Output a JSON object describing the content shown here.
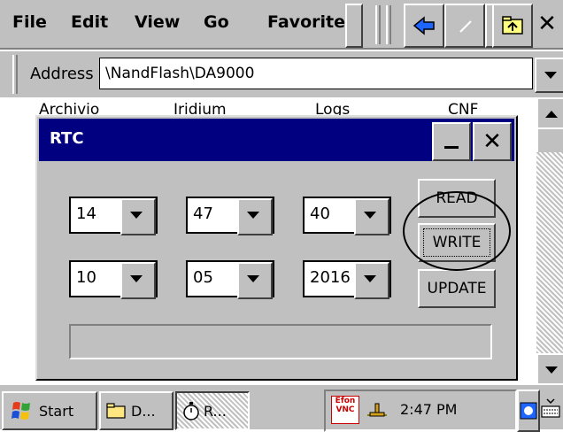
{
  "menubar": {
    "file": "File",
    "edit": "Edit",
    "view": "View",
    "go": "Go",
    "favorites": "Favorites",
    "icons": [
      "back-icon",
      "stop-icon",
      "folder-up-icon",
      "close-icon"
    ]
  },
  "address": {
    "label": "Address",
    "value": "\\NandFlash\\DA9000"
  },
  "folder_headers": [
    "Archivio",
    "Iridium",
    "Logs",
    "CNF"
  ],
  "dialog": {
    "title": "RTC",
    "time": {
      "hour": "14",
      "minute": "47",
      "second": "40"
    },
    "date": {
      "day": "10",
      "month": "05",
      "year": "2016"
    },
    "buttons": {
      "read": "READ",
      "write": "WRITE",
      "update": "UPDATE"
    },
    "status": ""
  },
  "taskbar": {
    "start": "Start",
    "tasks": [
      "D...",
      "R..."
    ],
    "tray_label": "Efon VNC",
    "clock": "2:47 PM"
  },
  "colors": {
    "titlebar": "#000080",
    "face": "#c0c0c0",
    "desktop": "#ffffff"
  }
}
